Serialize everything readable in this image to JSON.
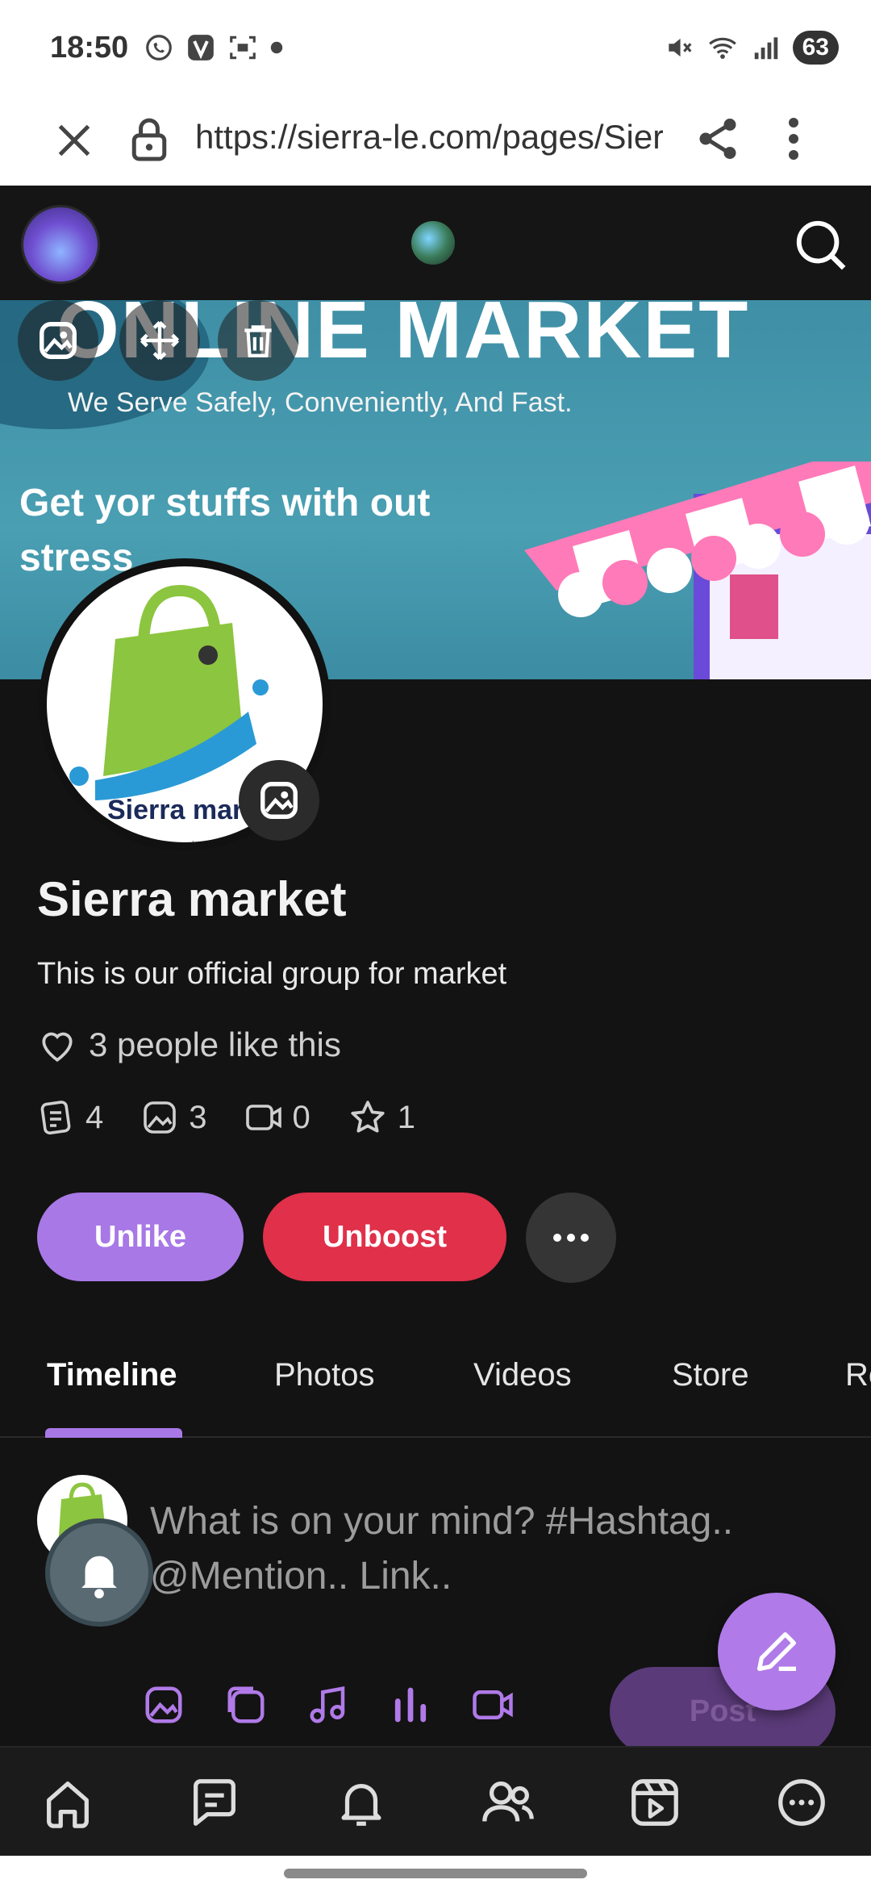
{
  "status_bar": {
    "time": "18:50",
    "battery": "63"
  },
  "browser": {
    "url": "https://sierra-le.com/pages/Sierra"
  },
  "cover": {
    "headline": "ONLINE MARKET",
    "tagline": "We Serve Safely, Conveniently, And Fast.",
    "slogan": "Get yor stuffs with out stress"
  },
  "profile": {
    "picture_label": "Sierra mar",
    "picture_small": "salone",
    "name": "Sierra market",
    "description": "This is our official group for market",
    "likes_text": "3 people like this",
    "stats": {
      "posts": "4",
      "photos": "3",
      "videos": "0",
      "reviews": "1"
    }
  },
  "actions": {
    "unlike_label": "Unlike",
    "unboost_label": "Unboost"
  },
  "tabs": [
    {
      "label": "Timeline",
      "active": true
    },
    {
      "label": "Photos",
      "active": false
    },
    {
      "label": "Videos",
      "active": false
    },
    {
      "label": "Store",
      "active": false
    },
    {
      "label": "Re",
      "active": false
    }
  ],
  "composer": {
    "placeholder": "What is on your mind? #Hashtag.. @Mention.. Link..",
    "post_label": "Post"
  },
  "bottom_nav": [
    "home-icon",
    "chat-icon",
    "bell-icon",
    "people-icon",
    "reels-icon",
    "more-icon"
  ],
  "colors": {
    "accent": "#a878e6",
    "danger": "#e0304a",
    "background": "#131313"
  }
}
